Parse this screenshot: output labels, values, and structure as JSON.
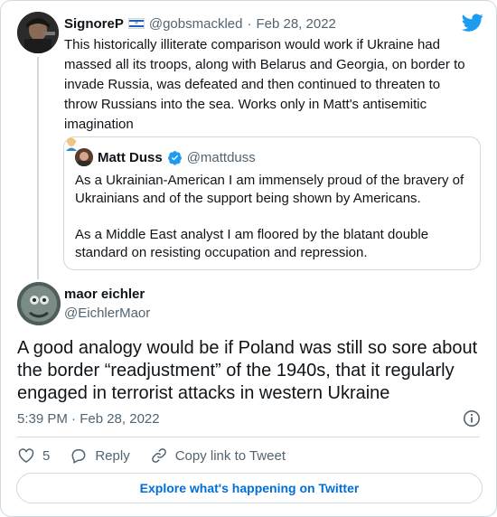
{
  "parent_tweet": {
    "display_name": "SignoreP",
    "handle": "@gobsmackled",
    "date_separator": "·",
    "date": "Feb 28, 2022",
    "text": "This historically illiterate comparison would work if Ukraine had massed all its troops, along with Belarus and Georgia, on border to invade Russia, was defeated and then continued to threaten to throw Russians into the sea. Works only in Matt's antisemitic imagination",
    "name_icon": "israel-flag-icon",
    "trailing_icon": "person-emoji-icon"
  },
  "quoted_tweet": {
    "display_name": "Matt Duss",
    "handle": "@mattduss",
    "verified": true,
    "paragraphs": [
      "As a Ukrainian-American I am immensely proud of the bravery of Ukrainians and of the support being shown by Americans.",
      "As a Middle East analyst I am floored by the blatant double standard on resisting occupation and repression."
    ]
  },
  "main_tweet": {
    "display_name": "maor eichler",
    "handle": "@EichlerMaor",
    "text": "A good analogy would be if Poland was still so sore about the border “readjustment” of the 1940s, that it regularly engaged in terrorist attacks in western Ukraine",
    "timestamp": "5:39 PM · Feb 28, 2022"
  },
  "actions": {
    "like_count": "5",
    "reply_label": "Reply",
    "copy_link_label": "Copy link to Tweet"
  },
  "footer": {
    "explore_label": "Explore what's happening on Twitter"
  },
  "colors": {
    "twitter_blue": "#1d9bf0",
    "link_blue": "#006fd6",
    "muted_text": "#536471",
    "border": "#cfd9de",
    "text": "#0f1419"
  }
}
